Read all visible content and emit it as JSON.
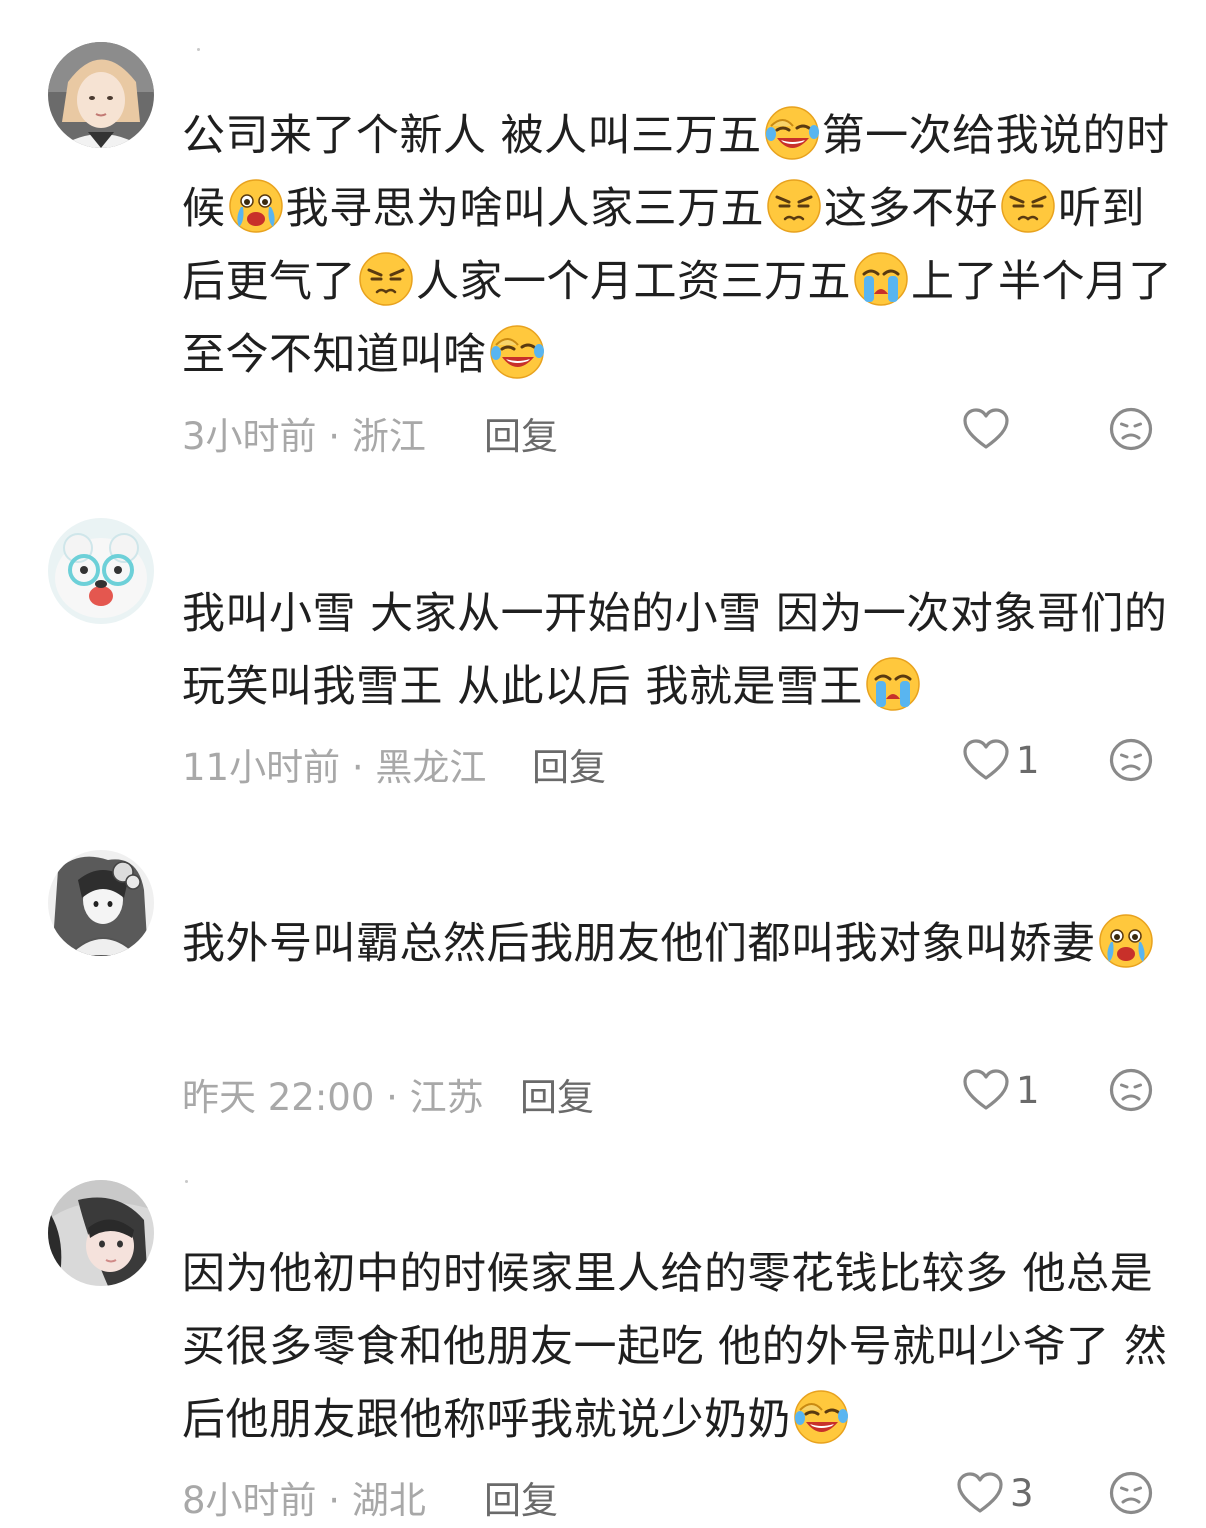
{
  "comments": [
    {
      "segments": [
        {
          "t": "公司来了个新人 被人叫三万五"
        },
        {
          "e": "laugh-cry"
        },
        {
          "t": "第一次给我说的时候"
        },
        {
          "e": "crying"
        },
        {
          "t": "我寻思为啥叫人家三万五"
        },
        {
          "e": "annoyed"
        },
        {
          "t": "这多不好"
        },
        {
          "e": "annoyed"
        },
        {
          "t": "听到后更气了"
        },
        {
          "e": "annoyed"
        },
        {
          "t": "人家一个月工资三万五"
        },
        {
          "e": "sobbing"
        },
        {
          "t": "上了半个月了 至今不知道叫啥"
        },
        {
          "e": "laugh-cry"
        }
      ],
      "meta": "3小时前 · 浙江",
      "reply": "回复",
      "likes": ""
    },
    {
      "segments": [
        {
          "t": "我叫小雪 大家从一开始的小雪 因为一次对象哥们的玩笑叫我雪王 从此以后 我就是雪王"
        },
        {
          "e": "sobbing"
        }
      ],
      "meta": "11小时前 · 黑龙江",
      "reply": "回复",
      "likes": "1"
    },
    {
      "segments": [
        {
          "t": "我外号叫霸总然后我朋友他们都叫我对象叫娇妻"
        },
        {
          "e": "crying"
        }
      ],
      "meta": "昨天 22:00 · 江苏",
      "reply": "回复",
      "likes": "1"
    },
    {
      "segments": [
        {
          "t": "因为他初中的时候家里人给的零花钱比较多 他总是买很多零食和他朋友一起吃 他的外号就叫少爷了 然后他朋友跟他称呼我就说少奶奶"
        },
        {
          "e": "laugh-cry"
        }
      ],
      "meta": "8小时前 · 湖北",
      "reply": "回复",
      "likes": "3"
    }
  ],
  "icons": {
    "like": "heart-outline-icon",
    "dislike": "frown-face-outline-icon"
  },
  "colors": {
    "text": "#1f1f1f",
    "meta": "#a8a8a8",
    "reply": "#6a6a6a",
    "icon": "#8a8a8a",
    "emoji_yellow": "#ffc83d"
  }
}
